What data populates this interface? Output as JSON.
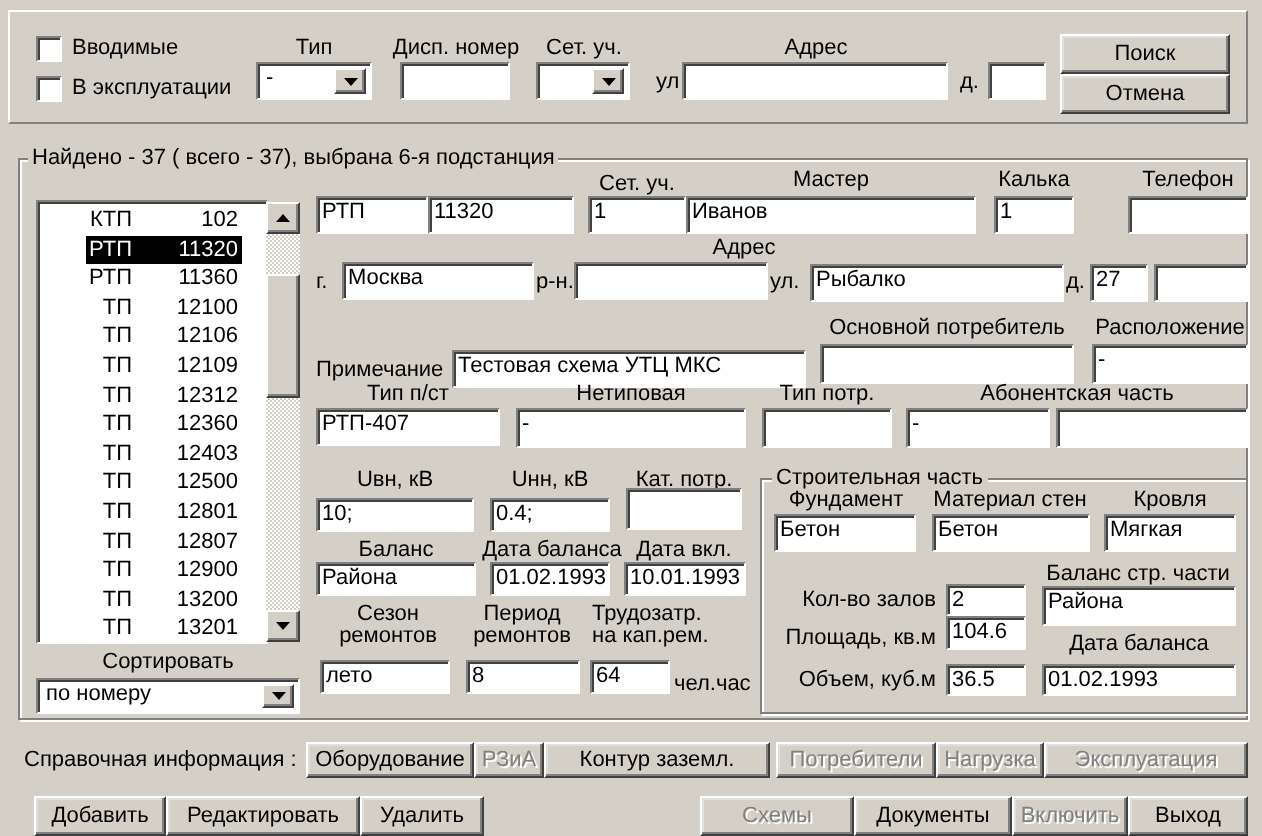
{
  "search_panel": {
    "controls": [
      {
        "kind": "checkbox",
        "label": "Вводимые",
        "checked": false
      },
      {
        "kind": "label",
        "text": "Тип"
      },
      {
        "kind": "label",
        "text": "Дисп. номер"
      },
      {
        "kind": "label",
        "text": "Сет. уч."
      },
      {
        "kind": "label",
        "text": "Адрес"
      },
      {
        "kind": "button",
        "label": "Поиск"
      },
      {
        "kind": "checkbox",
        "label": "В эксплуатации",
        "checked": false
      },
      {
        "kind": "combo",
        "value": "-"
      },
      {
        "kind": "field"
      },
      {
        "kind": "combo"
      },
      {
        "kind": "label",
        "text": "ул"
      },
      {
        "kind": "field"
      },
      {
        "kind": "label",
        "text": "д."
      },
      {
        "kind": "field"
      },
      {
        "kind": "button",
        "label": "Отмена"
      }
    ]
  },
  "results": {
    "title": "Найдено - 37 ( всего - 37), выбрана 6-я подстанция",
    "list": [
      {
        "type": "КТП",
        "number": "102",
        "selected": false
      },
      {
        "type": "РТП",
        "number": "11320",
        "selected": true
      },
      {
        "type": "РТП",
        "number": "11360",
        "selected": false
      },
      {
        "type": "ТП",
        "number": "12100",
        "selected": false
      },
      {
        "type": "ТП",
        "number": "12106",
        "selected": false
      },
      {
        "type": "ТП",
        "number": "12109",
        "selected": false
      },
      {
        "type": "ТП",
        "number": "12312",
        "selected": false
      },
      {
        "type": "ТП",
        "number": "12360",
        "selected": false
      },
      {
        "type": "ТП",
        "number": "12403",
        "selected": false
      },
      {
        "type": "ТП",
        "number": "12500",
        "selected": false
      },
      {
        "type": "ТП",
        "number": "12801",
        "selected": false
      },
      {
        "type": "ТП",
        "number": "12807",
        "selected": false
      },
      {
        "type": "ТП",
        "number": "12900",
        "selected": false
      },
      {
        "type": "ТП",
        "number": "13200",
        "selected": false
      },
      {
        "type": "ТП",
        "number": "13201",
        "selected": false
      }
    ],
    "sort_label": "Сортировать",
    "sort_combo": {
      "value": "по номеру"
    }
  },
  "details": {
    "controls": [
      {
        "kind": "label",
        "text": "Сет. уч."
      },
      {
        "kind": "label",
        "text": "Мастер"
      },
      {
        "kind": "label",
        "text": "Калька"
      },
      {
        "kind": "label",
        "text": "Телефон"
      },
      {
        "kind": "field",
        "value": "РТП"
      },
      {
        "kind": "field",
        "value": "11320"
      },
      {
        "kind": "field",
        "value": "1"
      },
      {
        "kind": "field",
        "value": "Иванов"
      },
      {
        "kind": "field",
        "value": "1"
      },
      {
        "kind": "field"
      },
      {
        "kind": "label",
        "text": "Адрес"
      },
      {
        "kind": "label",
        "text": "г."
      },
      {
        "kind": "field",
        "value": "Москва"
      },
      {
        "kind": "label",
        "text": "р-н."
      },
      {
        "kind": "field"
      },
      {
        "kind": "label",
        "text": "ул."
      },
      {
        "kind": "field",
        "value": "Рыбалко"
      },
      {
        "kind": "label",
        "text": "д."
      },
      {
        "kind": "field",
        "value": "27"
      },
      {
        "kind": "field"
      },
      {
        "kind": "label",
        "text": "Основной потребитель"
      },
      {
        "kind": "label",
        "text": "Расположение"
      },
      {
        "kind": "label",
        "text": "Примечание"
      },
      {
        "kind": "field",
        "value": "Тестовая схема УТЦ МКС"
      },
      {
        "kind": "field"
      },
      {
        "kind": "field",
        "value": "-"
      },
      {
        "kind": "label",
        "text": "Тип п/ст"
      },
      {
        "kind": "label",
        "text": "Нетиповая"
      },
      {
        "kind": "label",
        "text": "Тип потр."
      },
      {
        "kind": "label",
        "text": "Абонентская часть"
      },
      {
        "kind": "field",
        "value": "РТП-407"
      },
      {
        "kind": "field",
        "value": "-"
      },
      {
        "kind": "field"
      },
      {
        "kind": "field",
        "value": "-"
      },
      {
        "kind": "field"
      },
      {
        "kind": "label",
        "text": "Uвн, кВ"
      },
      {
        "kind": "label",
        "text": "Uнн, кВ"
      },
      {
        "kind": "label",
        "text": "Кат. потр."
      },
      {
        "kind": "field",
        "value": "10;"
      },
      {
        "kind": "field",
        "value": "0.4;"
      },
      {
        "kind": "field"
      },
      {
        "kind": "label",
        "text": "Баланс"
      },
      {
        "kind": "label",
        "text": "Дата баланса"
      },
      {
        "kind": "label",
        "text": "Дата вкл."
      },
      {
        "kind": "field",
        "value": "Района"
      },
      {
        "kind": "field",
        "value": "01.02.1993"
      },
      {
        "kind": "field",
        "value": "10.01.1993"
      },
      {
        "kind": "label",
        "text": "Сезон ремонтов"
      },
      {
        "kind": "label",
        "text": "Период ремонтов"
      },
      {
        "kind": "label",
        "text": "Трудозатр. на кап.рем."
      },
      {
        "kind": "field",
        "value": "лето"
      },
      {
        "kind": "field",
        "value": "8"
      },
      {
        "kind": "field",
        "value": "64"
      },
      {
        "kind": "label",
        "text": "чел.час"
      }
    ]
  },
  "construction": {
    "title": "Строительная часть",
    "controls": [
      {
        "kind": "label",
        "text": "Фундамент"
      },
      {
        "kind": "label",
        "text": "Материал стен"
      },
      {
        "kind": "label",
        "text": "Кровля"
      },
      {
        "kind": "field",
        "value": "Бетон"
      },
      {
        "kind": "field",
        "value": "Бетон"
      },
      {
        "kind": "field",
        "value": "Мягкая"
      },
      {
        "kind": "label",
        "text": "Кол-во залов"
      },
      {
        "kind": "field",
        "value": "2"
      },
      {
        "kind": "label",
        "text": "Баланс стр. части"
      },
      {
        "kind": "field",
        "value": "Района"
      },
      {
        "kind": "label",
        "text": "Площадь, кв.м"
      },
      {
        "kind": "field",
        "value": "104.6"
      },
      {
        "kind": "label",
        "text": "Дата баланса"
      },
      {
        "kind": "label",
        "text": "Объем, куб.м"
      },
      {
        "kind": "field",
        "value": "36.5"
      },
      {
        "kind": "field",
        "value": "01.02.1993"
      }
    ]
  },
  "reference_bar": {
    "label": "Справочная информация :",
    "buttons": [
      {
        "label": "Оборудование",
        "disabled": false
      },
      {
        "label": "РЗиА",
        "disabled": true
      },
      {
        "label": "Контур заземл.",
        "disabled": false
      },
      {
        "label": "Потребители",
        "disabled": true
      },
      {
        "label": "Нагрузка",
        "disabled": true
      },
      {
        "label": "Эксплуатация",
        "disabled": true
      }
    ]
  },
  "action_buttons": [
    {
      "label": "Добавить",
      "disabled": false
    },
    {
      "label": "Редактировать",
      "disabled": false
    },
    {
      "label": "Удалить",
      "disabled": false
    },
    {
      "label": "Схемы",
      "disabled": true
    },
    {
      "label": "Документы",
      "disabled": false
    },
    {
      "label": "Включить",
      "disabled": true
    },
    {
      "label": "Выход",
      "disabled": false
    }
  ]
}
